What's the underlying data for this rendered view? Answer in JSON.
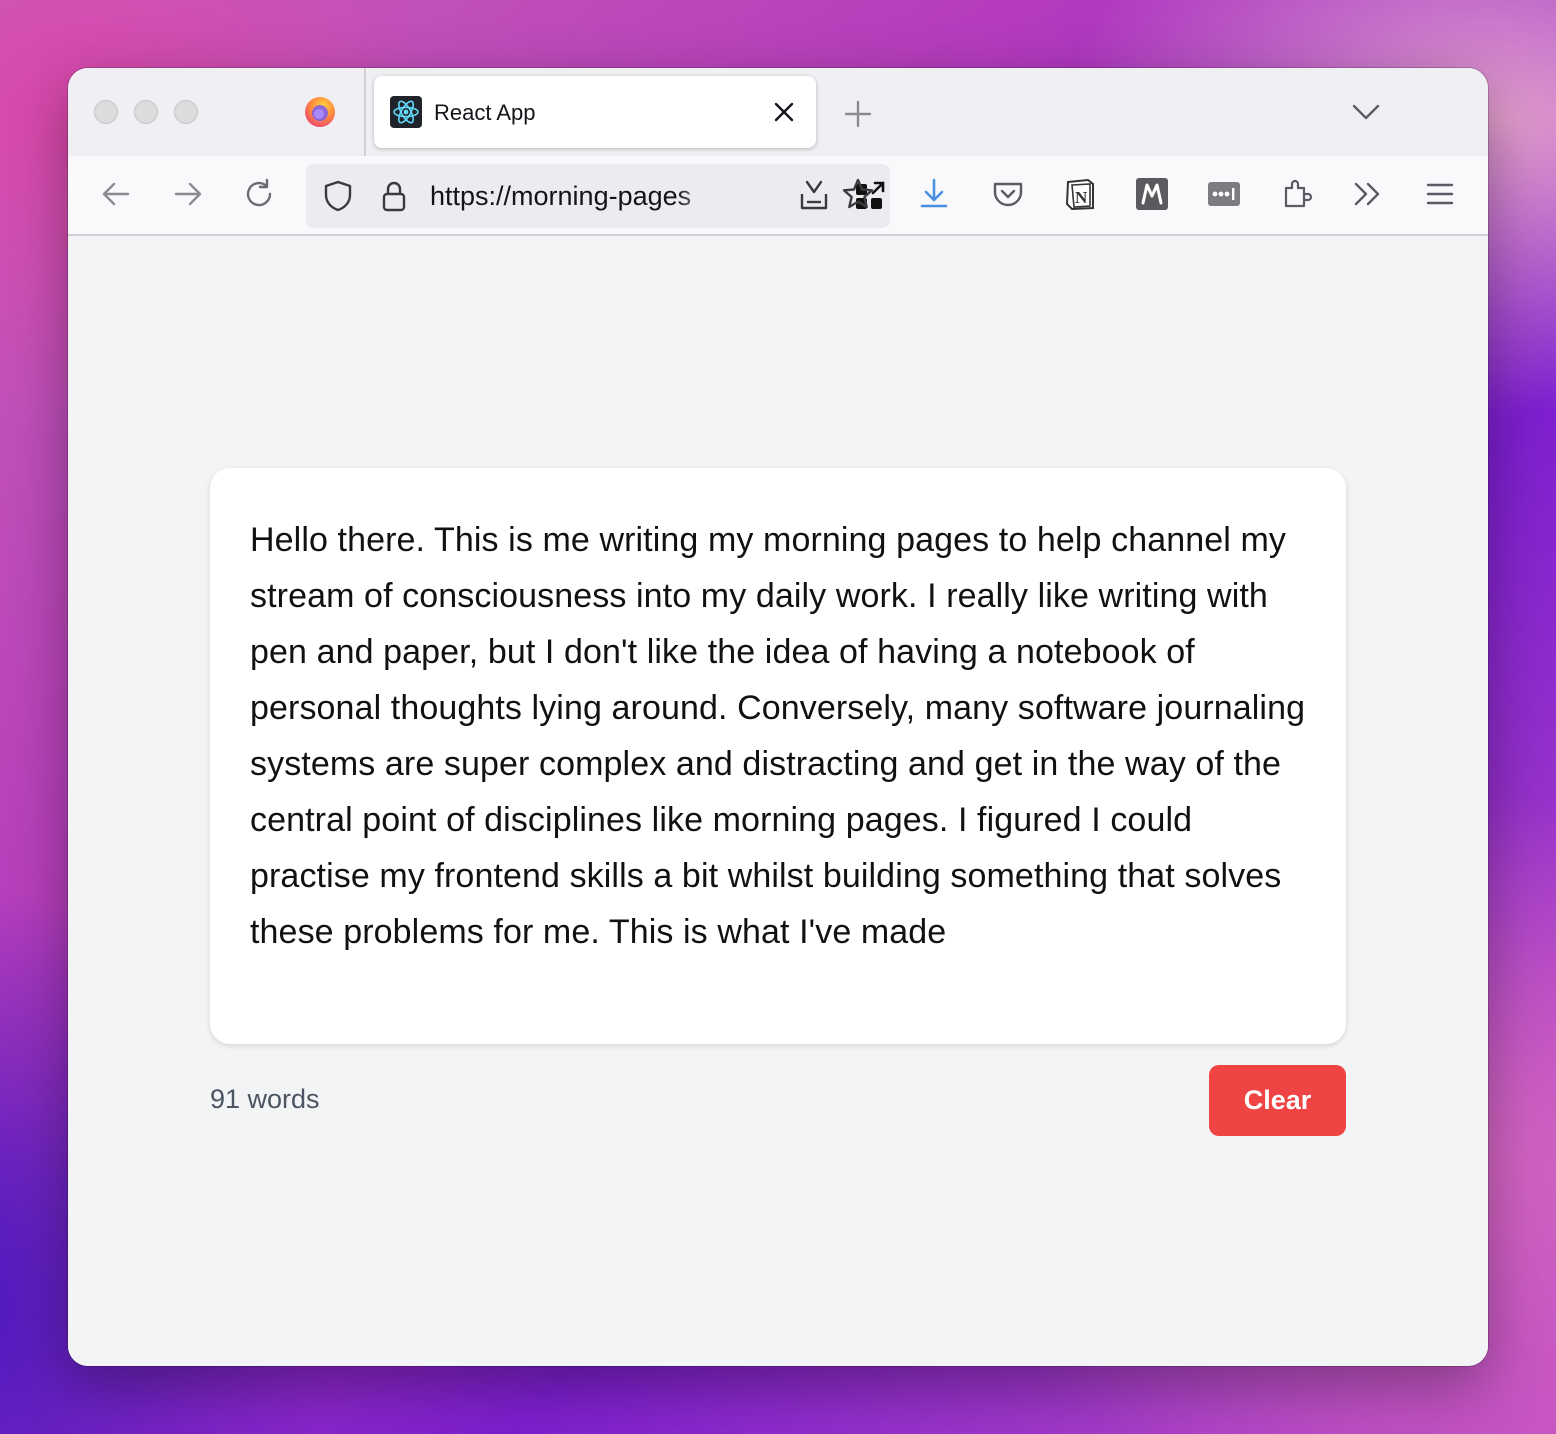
{
  "browser": {
    "tab": {
      "title": "React App",
      "favicon": "react-icon"
    },
    "url": "https://morning-pages",
    "toolbar_icons": [
      "back-icon",
      "forward-icon",
      "reload-icon",
      "shield-icon",
      "lock-icon",
      "save-to-reading-icon",
      "qr-code-icon",
      "bookmark-star-icon",
      "download-icon",
      "pocket-icon",
      "notion-icon",
      "m-extension-icon",
      "dots-extension-icon",
      "extensions-icon",
      "overflow-icon",
      "menu-icon"
    ]
  },
  "editor": {
    "text": "Hello there. This is me writing my morning pages to help channel my stream of consciousness into my daily work. I really like writing with pen and paper, but I don't like the idea of having a notebook of personal thoughts lying around. Conversely, many software journaling systems are super complex and distracting and get in the way of the central point of disciplines like morning pages. I figured I could practise my frontend skills a bit whilst building something that solves these problems for me. This is what I've made"
  },
  "footer": {
    "word_count": "91 words",
    "clear_label": "Clear"
  },
  "colors": {
    "clear_button": "#ef4444",
    "download_accent": "#4a90e2"
  }
}
